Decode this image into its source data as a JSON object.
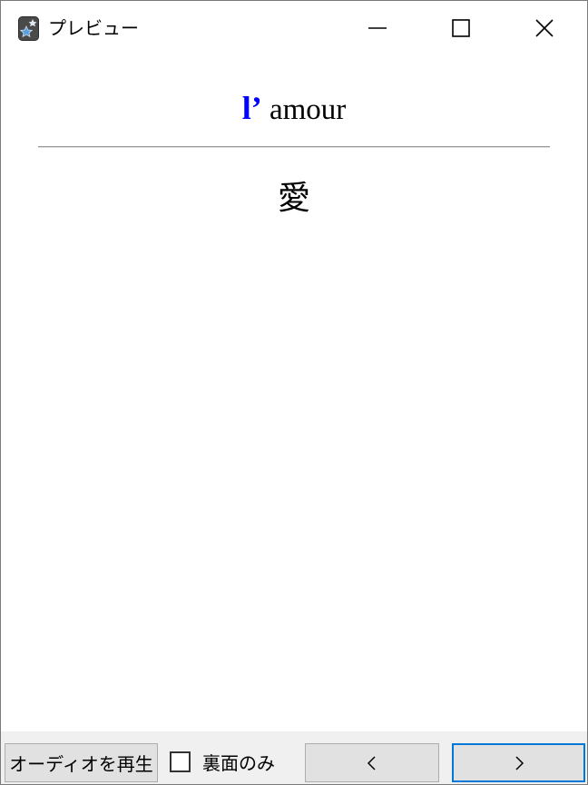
{
  "window": {
    "title": "プレビュー",
    "icon": "anki-star-icon"
  },
  "card": {
    "front_article": "l’",
    "front_word": "amour",
    "back_text": "愛",
    "article_color": "#0000ff"
  },
  "controls": {
    "play_audio_label": "オーディオを再生",
    "back_only_label": "裏面のみ",
    "back_only_checked": false,
    "prev_glyph": "<",
    "next_glyph": ">"
  },
  "colors": {
    "accent_focus": "#0078d7",
    "button_bg": "#e1e1e1",
    "bar_bg": "#f0f0f0"
  }
}
